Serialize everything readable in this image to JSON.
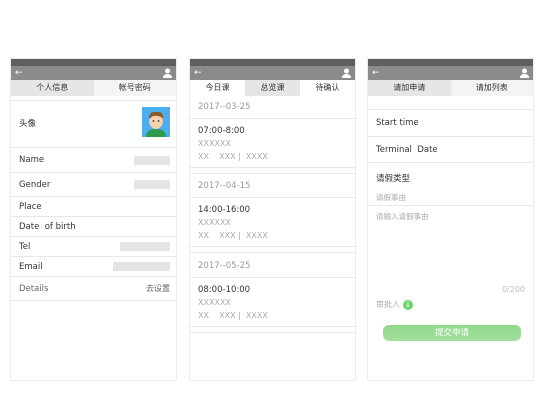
{
  "profile": {
    "tabs": [
      "个人信息",
      "帐号密码"
    ],
    "avatar_label": "头像",
    "fields": [
      "Name",
      "Gender",
      "Place",
      "Date  of birth",
      "Tel",
      "Email"
    ],
    "details_label": "Details",
    "details_action": "去设置"
  },
  "schedule": {
    "tabs": [
      "今日课",
      "总览课",
      "待确认"
    ],
    "groups": [
      {
        "date": "2017--03-25",
        "time": "07:00-8:00",
        "title": "XXXXXX",
        "meta": "XX    XXX |  XXXX"
      },
      {
        "date": "2017--04-15",
        "time": "14:00-16:00",
        "title": "XXXXXX",
        "meta": "XX    XXX |  XXXX"
      },
      {
        "date": "2017--05-25",
        "time": "08:00-10:00",
        "title": "XXXXXX",
        "meta": "XX    XXX |  XXXX"
      }
    ]
  },
  "leave": {
    "tabs": [
      "请加申请",
      "请加列表"
    ],
    "start": "Start time",
    "end": "Terminal  Date",
    "type": "请假类型",
    "reason_label": "请假事由",
    "reason_placeholder": "请输入请假事由",
    "counter": "0/200",
    "approver": "审批人",
    "submit": "提交申请"
  },
  "icons": {
    "back": "arrow-left-icon",
    "user": "user-icon"
  },
  "colors": {
    "accent": "#8fd98a",
    "header": "#8b8b8b"
  }
}
